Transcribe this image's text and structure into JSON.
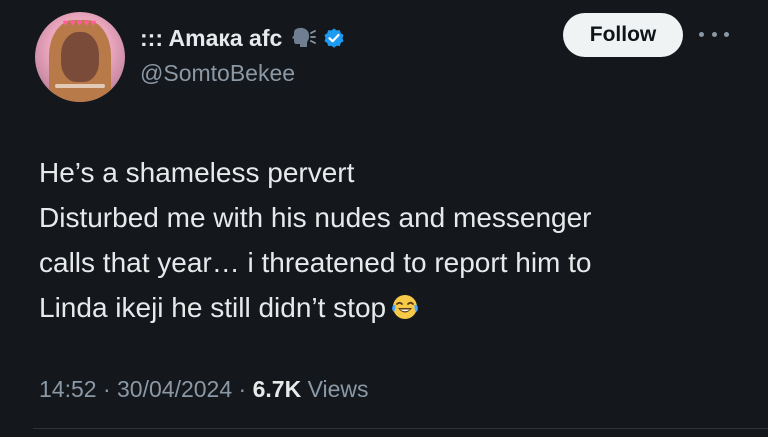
{
  "author": {
    "display_name": "::: Amaка afc",
    "handle": "@SomtoBekee",
    "avatar_icon": "profile-photo",
    "emoji_icon": "speaking-head-icon",
    "verified_icon": "verified-badge-icon",
    "verified_color": "#1d9bf0"
  },
  "actions": {
    "follow_label": "Follow",
    "more_icon": "more-options-icon"
  },
  "tweet": {
    "lines": [
      "He’s a shameless pervert",
      "Disturbed me with his nudes and messenger",
      "calls that year… i threatened to report him to",
      "Linda ikeji he still didn’t stop"
    ],
    "trailing_emoji": "face-with-tears-of-joy-icon"
  },
  "meta": {
    "time": "14:52",
    "separator": " · ",
    "date": "30/04/2024",
    "views_count": "6.7K",
    "views_label": " Views"
  },
  "colors": {
    "background": "#14171c",
    "text_primary": "#e7e9ea",
    "text_secondary": "#8b98a5",
    "follow_bg": "#eff3f4"
  }
}
